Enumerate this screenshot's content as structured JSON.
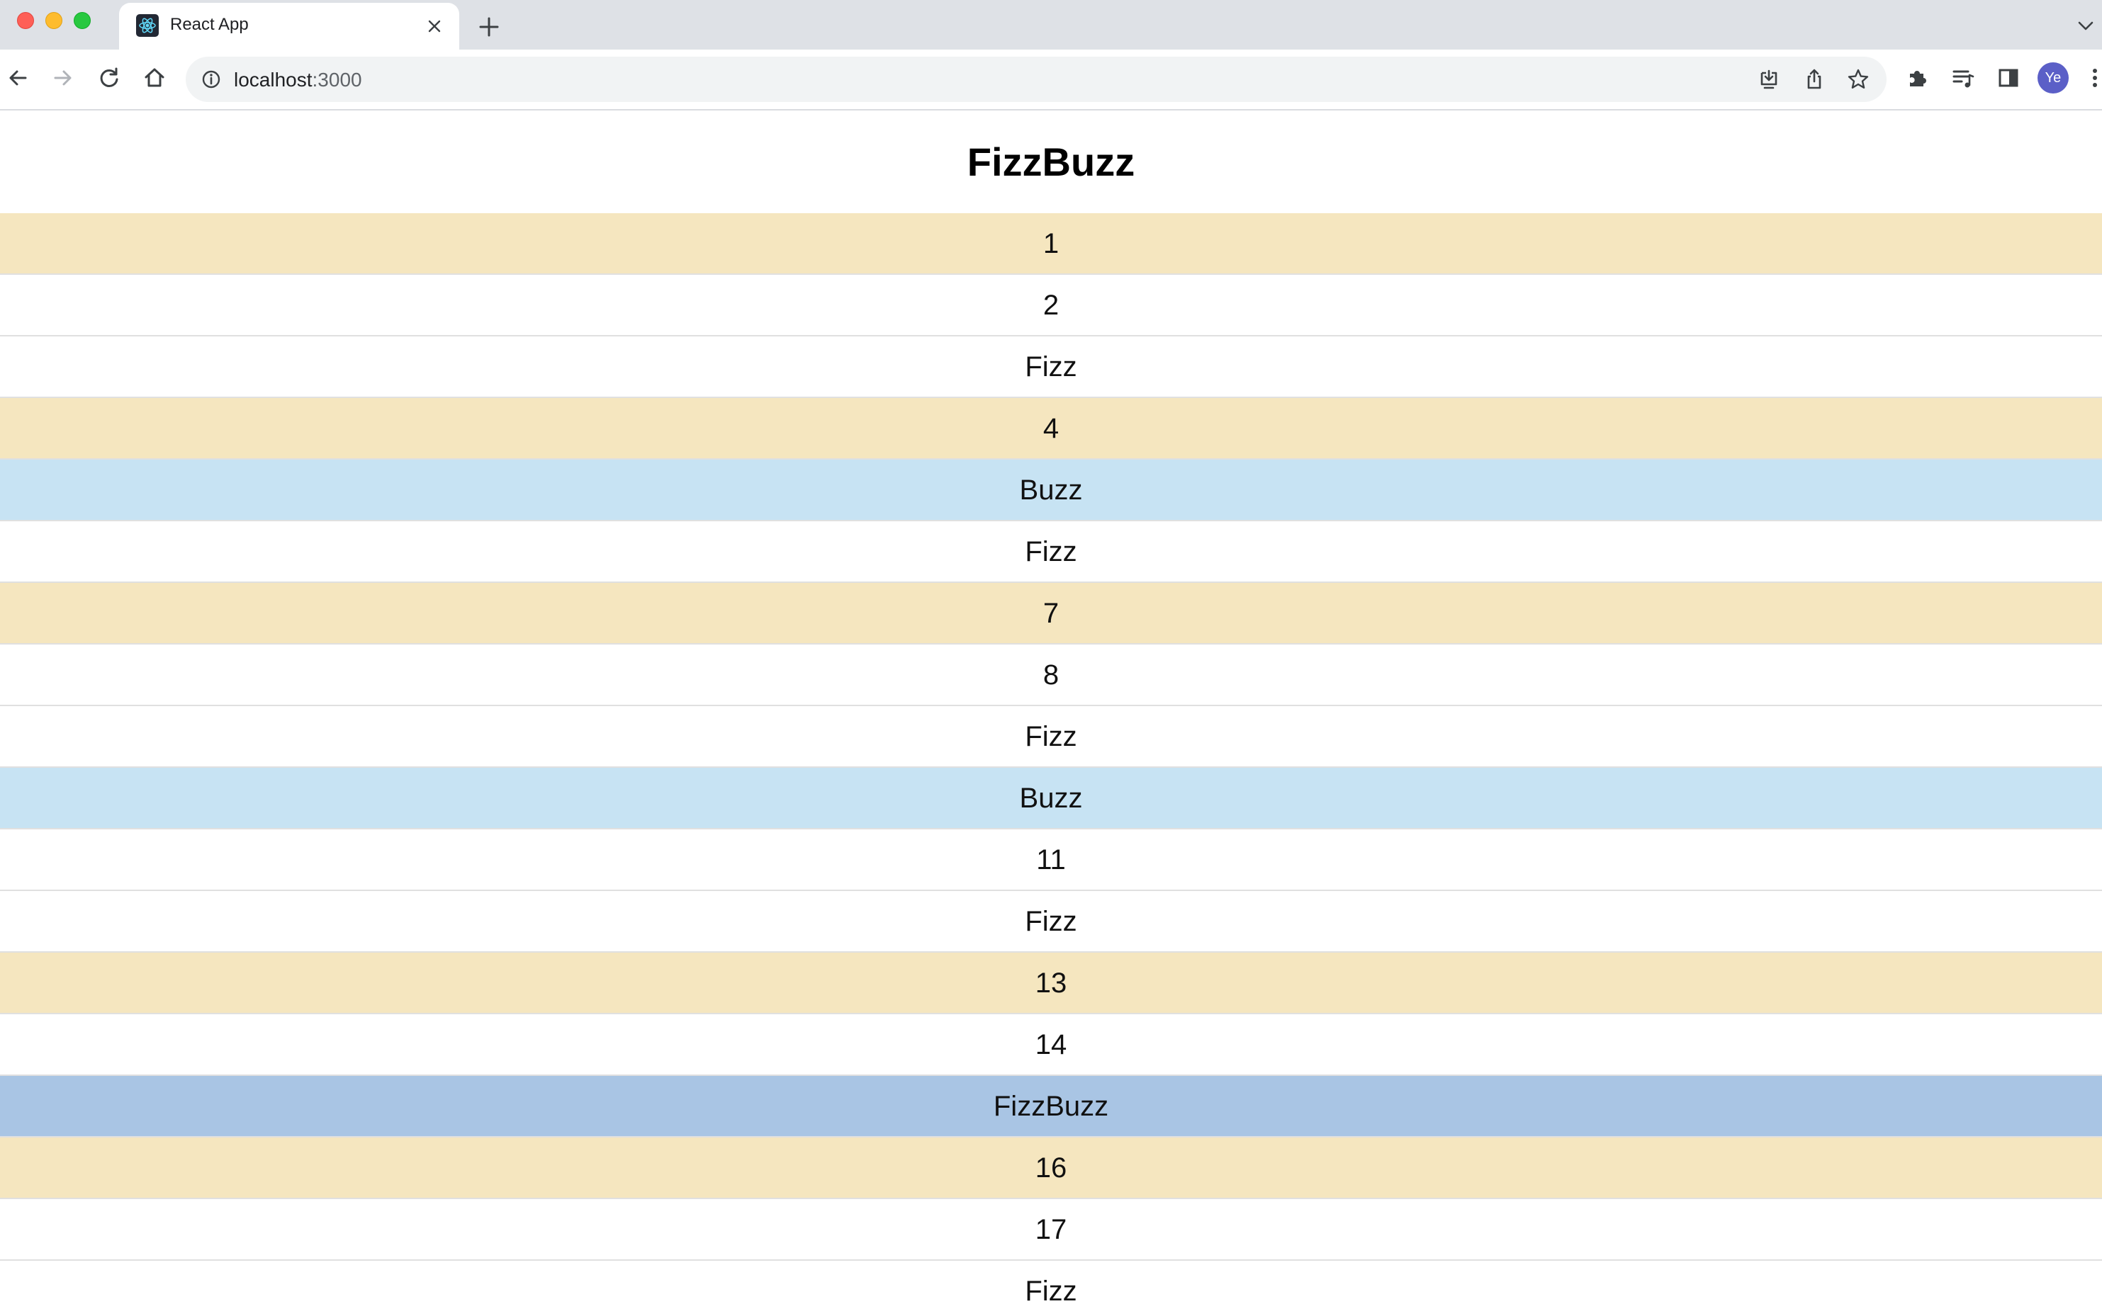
{
  "browser": {
    "tab_title": "React App",
    "url_host": "localhost",
    "url_port": ":3000",
    "profile_initials": "Ye"
  },
  "page": {
    "title": "FizzBuzz",
    "rows": [
      {
        "text": "1",
        "kind": "number-prime"
      },
      {
        "text": "2",
        "kind": "number-plain"
      },
      {
        "text": "Fizz",
        "kind": "fizz"
      },
      {
        "text": "4",
        "kind": "number-prime"
      },
      {
        "text": "Buzz",
        "kind": "buzz"
      },
      {
        "text": "Fizz",
        "kind": "fizz"
      },
      {
        "text": "7",
        "kind": "number-prime"
      },
      {
        "text": "8",
        "kind": "number-plain"
      },
      {
        "text": "Fizz",
        "kind": "fizz"
      },
      {
        "text": "Buzz",
        "kind": "buzz"
      },
      {
        "text": "11",
        "kind": "number-plain"
      },
      {
        "text": "Fizz",
        "kind": "fizz"
      },
      {
        "text": "13",
        "kind": "number-prime"
      },
      {
        "text": "14",
        "kind": "number-plain"
      },
      {
        "text": "FizzBuzz",
        "kind": "fizzbuzz"
      },
      {
        "text": "16",
        "kind": "number-prime"
      },
      {
        "text": "17",
        "kind": "number-plain"
      },
      {
        "text": "Fizz",
        "kind": "fizz"
      }
    ]
  },
  "colors": {
    "highlight_row": "#f5e6bf",
    "buzz_row": "#c7e3f3",
    "fizzbuzz_row": "#a9c5e4",
    "plain_row": "#ffffff"
  },
  "icons": {
    "toolbar": [
      "back-icon",
      "forward-icon",
      "reload-icon",
      "home-icon"
    ],
    "omnibox": [
      "site-info-icon",
      "install-app-icon",
      "share-icon",
      "bookmark-star-icon"
    ],
    "right": [
      "extensions-puzzle-icon",
      "reading-list-icon",
      "side-panel-icon",
      "menu-kebab-icon"
    ]
  }
}
